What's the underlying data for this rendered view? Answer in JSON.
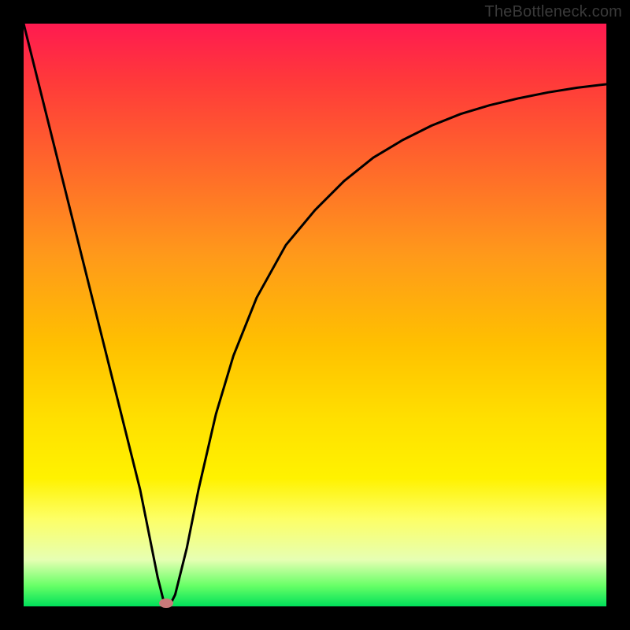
{
  "watermark": "TheBottleneck.com",
  "chart_data": {
    "type": "line",
    "title": "",
    "xlabel": "",
    "ylabel": "",
    "xlim": [
      0,
      100
    ],
    "ylim": [
      0,
      100
    ],
    "series": [
      {
        "name": "bottleneck-curve",
        "x": [
          0,
          5,
          10,
          15,
          20,
          22,
          23,
          24,
          25,
          26,
          28,
          30,
          33,
          36,
          40,
          45,
          50,
          55,
          60,
          65,
          70,
          75,
          80,
          85,
          90,
          95,
          100
        ],
        "values": [
          100,
          80,
          60,
          40,
          20,
          10,
          5,
          1,
          0,
          2,
          10,
          20,
          33,
          43,
          53,
          62,
          68,
          73,
          77,
          80,
          82.5,
          84.5,
          86,
          87.2,
          88.2,
          89,
          89.6
        ]
      }
    ],
    "marker": {
      "x": 24.5,
      "y": 0.5
    },
    "gradient_stops": [
      {
        "pos": 0,
        "color": "#ff1a50"
      },
      {
        "pos": 0.55,
        "color": "#ffc000"
      },
      {
        "pos": 0.85,
        "color": "#fdff66"
      },
      {
        "pos": 1.0,
        "color": "#00e05a"
      }
    ]
  }
}
